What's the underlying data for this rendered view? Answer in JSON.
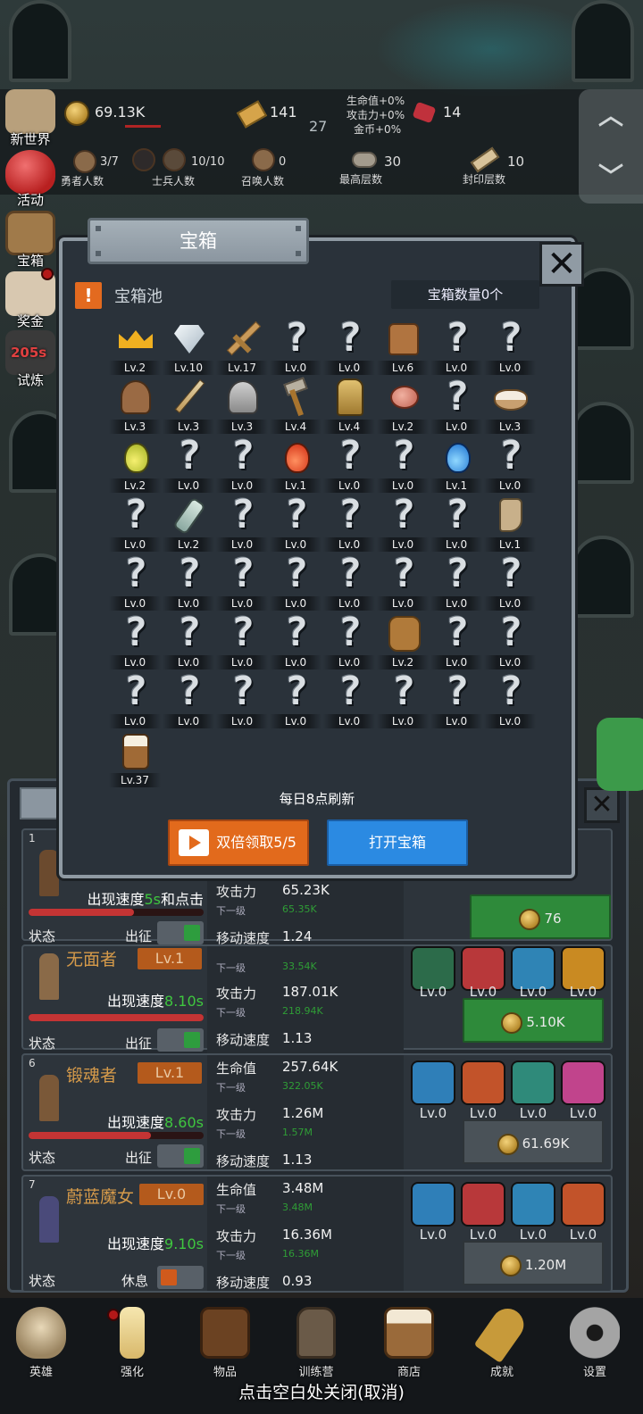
{
  "hud": {
    "gold": "69.13K",
    "bars": "141",
    "wave": "27",
    "buffs": [
      "生命值+0%",
      "攻击力+0%",
      "金币+0%"
    ],
    "gems": "14",
    "heroes_count": "3/7",
    "heroes_label": "勇者人数",
    "soldiers_count": "10/10",
    "soldiers_label": "士兵人数",
    "summon_count": "0",
    "summon_label": "召唤人数",
    "max_floor": "30",
    "max_floor_label": "最高层数",
    "seal_floor": "10",
    "seal_floor_label": "封印层数"
  },
  "side_menu": [
    {
      "label": "新世界",
      "icon": "map-icon"
    },
    {
      "label": "活动",
      "icon": "heart-icon"
    },
    {
      "label": "宝箱",
      "icon": "chest-icon"
    },
    {
      "label": "奖金",
      "icon": "envelope-icon"
    },
    {
      "label": "试炼",
      "icon": "trial-icon",
      "timer": "205s"
    }
  ],
  "modal": {
    "title": "宝箱",
    "pool_label": "宝箱池",
    "chest_count": "宝箱数量0个",
    "refresh_text": "每日8点刷新",
    "double_button": "双倍领取5/5",
    "open_button": "打开宝箱",
    "items": [
      {
        "icon": "crown-icon",
        "lv": "Lv.2"
      },
      {
        "icon": "diamond-icon",
        "lv": "Lv.10"
      },
      {
        "icon": "wooden-sword-icon",
        "lv": "Lv.17"
      },
      {
        "icon": "unknown-icon",
        "lv": "Lv.0"
      },
      {
        "icon": "unknown-icon",
        "lv": "Lv.0"
      },
      {
        "icon": "leather-armor-icon",
        "lv": "Lv.6"
      },
      {
        "icon": "unknown-icon",
        "lv": "Lv.0"
      },
      {
        "icon": "unknown-icon",
        "lv": "Lv.0"
      },
      {
        "icon": "leather-helmet-icon",
        "lv": "Lv.3"
      },
      {
        "icon": "dagger-icon",
        "lv": "Lv.3"
      },
      {
        "icon": "iron-helmet-icon",
        "lv": "Lv.3"
      },
      {
        "icon": "hammer-icon",
        "lv": "Lv.4"
      },
      {
        "icon": "knight-helmet-icon",
        "lv": "Lv.4"
      },
      {
        "icon": "meat-icon",
        "lv": "Lv.2"
      },
      {
        "icon": "unknown-icon",
        "lv": "Lv.0"
      },
      {
        "icon": "flour-bowl-icon",
        "lv": "Lv.3"
      },
      {
        "icon": "yellow-potion-icon",
        "lv": "Lv.2"
      },
      {
        "icon": "unknown-icon",
        "lv": "Lv.0"
      },
      {
        "icon": "unknown-icon",
        "lv": "Lv.0"
      },
      {
        "icon": "red-potion-icon",
        "lv": "Lv.1"
      },
      {
        "icon": "unknown-icon",
        "lv": "Lv.0"
      },
      {
        "icon": "unknown-icon",
        "lv": "Lv.0"
      },
      {
        "icon": "blue-potion-icon",
        "lv": "Lv.1"
      },
      {
        "icon": "unknown-icon",
        "lv": "Lv.0"
      },
      {
        "icon": "unknown-icon",
        "lv": "Lv.0"
      },
      {
        "icon": "empty-bottle-icon",
        "lv": "Lv.2"
      },
      {
        "icon": "unknown-icon",
        "lv": "Lv.0"
      },
      {
        "icon": "unknown-icon",
        "lv": "Lv.0"
      },
      {
        "icon": "unknown-icon",
        "lv": "Lv.0"
      },
      {
        "icon": "unknown-icon",
        "lv": "Lv.0"
      },
      {
        "icon": "unknown-icon",
        "lv": "Lv.0"
      },
      {
        "icon": "boot-icon",
        "lv": "Lv.1"
      },
      {
        "icon": "unknown-icon",
        "lv": "Lv.0"
      },
      {
        "icon": "unknown-icon",
        "lv": "Lv.0"
      },
      {
        "icon": "unknown-icon",
        "lv": "Lv.0"
      },
      {
        "icon": "unknown-icon",
        "lv": "Lv.0"
      },
      {
        "icon": "unknown-icon",
        "lv": "Lv.0"
      },
      {
        "icon": "unknown-icon",
        "lv": "Lv.0"
      },
      {
        "icon": "unknown-icon",
        "lv": "Lv.0"
      },
      {
        "icon": "unknown-icon",
        "lv": "Lv.0"
      },
      {
        "icon": "unknown-icon",
        "lv": "Lv.0"
      },
      {
        "icon": "unknown-icon",
        "lv": "Lv.0"
      },
      {
        "icon": "unknown-icon",
        "lv": "Lv.0"
      },
      {
        "icon": "unknown-icon",
        "lv": "Lv.0"
      },
      {
        "icon": "unknown-icon",
        "lv": "Lv.0"
      },
      {
        "icon": "backpack-icon",
        "lv": "Lv.2"
      },
      {
        "icon": "unknown-icon",
        "lv": "Lv.0"
      },
      {
        "icon": "unknown-icon",
        "lv": "Lv.0"
      },
      {
        "icon": "unknown-icon",
        "lv": "Lv.0"
      },
      {
        "icon": "unknown-icon",
        "lv": "Lv.0"
      },
      {
        "icon": "unknown-icon",
        "lv": "Lv.0"
      },
      {
        "icon": "unknown-icon",
        "lv": "Lv.0"
      },
      {
        "icon": "unknown-icon",
        "lv": "Lv.0"
      },
      {
        "icon": "unknown-icon",
        "lv": "Lv.0"
      },
      {
        "icon": "unknown-icon",
        "lv": "Lv.0"
      },
      {
        "icon": "unknown-icon",
        "lv": "Lv.0"
      },
      {
        "icon": "beer-mug-icon",
        "lv": "Lv.37"
      }
    ]
  },
  "heroes": [
    {
      "rank": "1",
      "name": "",
      "level": "",
      "speed_prefix": "出现速度",
      "speed_value": "5s",
      "speed_suffix": "和点击",
      "hp_fill": 0.6,
      "status_label": "状态",
      "deploy_label": "出征",
      "toggle_color": "#2e9d3e",
      "hp_label": "",
      "hp_value": "",
      "hp_next_label": "",
      "hp_next": "",
      "atk_label": "攻击力",
      "atk_value": "65.23K",
      "atk_next_label": "下一级",
      "atk_next": "65.35K",
      "move_label": "移动速度",
      "move_value": "1.24",
      "skills": [],
      "upgrade": "76",
      "upgrade_style": "green"
    },
    {
      "rank": "",
      "name": "无面者",
      "level": "Lv.1",
      "speed_prefix": "出现速度",
      "speed_value": "8.10s",
      "speed_suffix": "",
      "hp_fill": 1.0,
      "status_label": "状态",
      "deploy_label": "出征",
      "toggle_color": "#2e9d3e",
      "hp_label": "",
      "hp_value": "",
      "hp_next_label": "下一级",
      "hp_next": "33.54K",
      "atk_label": "攻击力",
      "atk_value": "187.01K",
      "atk_next_label": "下一级",
      "atk_next": "218.94K",
      "move_label": "移动速度",
      "move_value": "1.13",
      "skills": [
        {
          "icon": "dark-blade-icon",
          "lv": "Lv.0",
          "color": "#2c6b4a"
        },
        {
          "icon": "sword-slash-icon",
          "lv": "Lv.0",
          "color": "#b8383a"
        },
        {
          "icon": "helmet-skill-icon",
          "lv": "Lv.0",
          "color": "#2f84b5"
        },
        {
          "icon": "warrior-skill-icon",
          "lv": "Lv.0",
          "color": "#c98a22"
        }
      ],
      "upgrade": "5.10K",
      "upgrade_style": "green"
    },
    {
      "rank": "6",
      "name": "锻魂者",
      "level": "Lv.1",
      "speed_prefix": "出现速度",
      "speed_value": "8.60s",
      "speed_suffix": "",
      "hp_fill": 0.7,
      "status_label": "状态",
      "deploy_label": "出征",
      "toggle_color": "#2e9d3e",
      "hp_label": "生命值",
      "hp_value": "257.64K",
      "hp_next_label": "下一级",
      "hp_next": "322.05K",
      "atk_label": "攻击力",
      "atk_value": "1.26M",
      "atk_next_label": "下一级",
      "atk_next": "1.57M",
      "move_label": "移动速度",
      "move_value": "1.13",
      "skills": [
        {
          "icon": "skull-shield-icon",
          "lv": "Lv.0",
          "color": "#2f7fb8"
        },
        {
          "icon": "axe-skill-icon",
          "lv": "Lv.0",
          "color": "#c2532a"
        },
        {
          "icon": "hammer-skill-icon",
          "lv": "Lv.0",
          "color": "#2f8a7a"
        },
        {
          "icon": "boot-skill-icon",
          "lv": "Lv.0",
          "color": "#c1448c"
        }
      ],
      "upgrade": "61.69K",
      "upgrade_style": "gray"
    },
    {
      "rank": "7",
      "name": "蔚蓝魔女",
      "level": "Lv.0",
      "speed_prefix": "出现速度",
      "speed_value": "9.10s",
      "speed_suffix": "",
      "hp_fill": 0.0,
      "status_label": "状态",
      "deploy_label": "休息",
      "toggle_color": "#d05a1c",
      "hp_label": "生命值",
      "hp_value": "3.48M",
      "hp_next_label": "下一级",
      "hp_next": "3.48M",
      "atk_label": "攻击力",
      "atk_value": "16.36M",
      "atk_next_label": "下一级",
      "atk_next": "16.36M",
      "move_label": "移动速度",
      "move_value": "0.93",
      "skills": [
        {
          "icon": "lightning-shield-icon",
          "lv": "Lv.0",
          "color": "#2f7fb8"
        },
        {
          "icon": "spear-skill-icon",
          "lv": "Lv.0",
          "color": "#b8383a"
        },
        {
          "icon": "wings-skill-icon",
          "lv": "Lv.0",
          "color": "#2f84b5"
        },
        {
          "icon": "hammer-strike-icon",
          "lv": "Lv.0",
          "color": "#c2532a"
        }
      ],
      "upgrade": "1.20M",
      "upgrade_style": "gray"
    }
  ],
  "nav": [
    {
      "label": "英雄",
      "icon": "skull-icon"
    },
    {
      "label": "强化",
      "icon": "candle-icon"
    },
    {
      "label": "物品",
      "icon": "book-icon"
    },
    {
      "label": "训练营",
      "icon": "lantern-icon"
    },
    {
      "label": "商店",
      "icon": "beer-icon"
    },
    {
      "label": "成就",
      "icon": "key-icon"
    },
    {
      "label": "设置",
      "icon": "gear-icon"
    }
  ],
  "close_hint": "点击空白处关闭(取消)",
  "colors": {
    "accent_orange": "#e26a1c",
    "accent_blue": "#2b8ae2",
    "speed_green": "#3fc63f",
    "upgrade_green": "#2e8a3a"
  }
}
